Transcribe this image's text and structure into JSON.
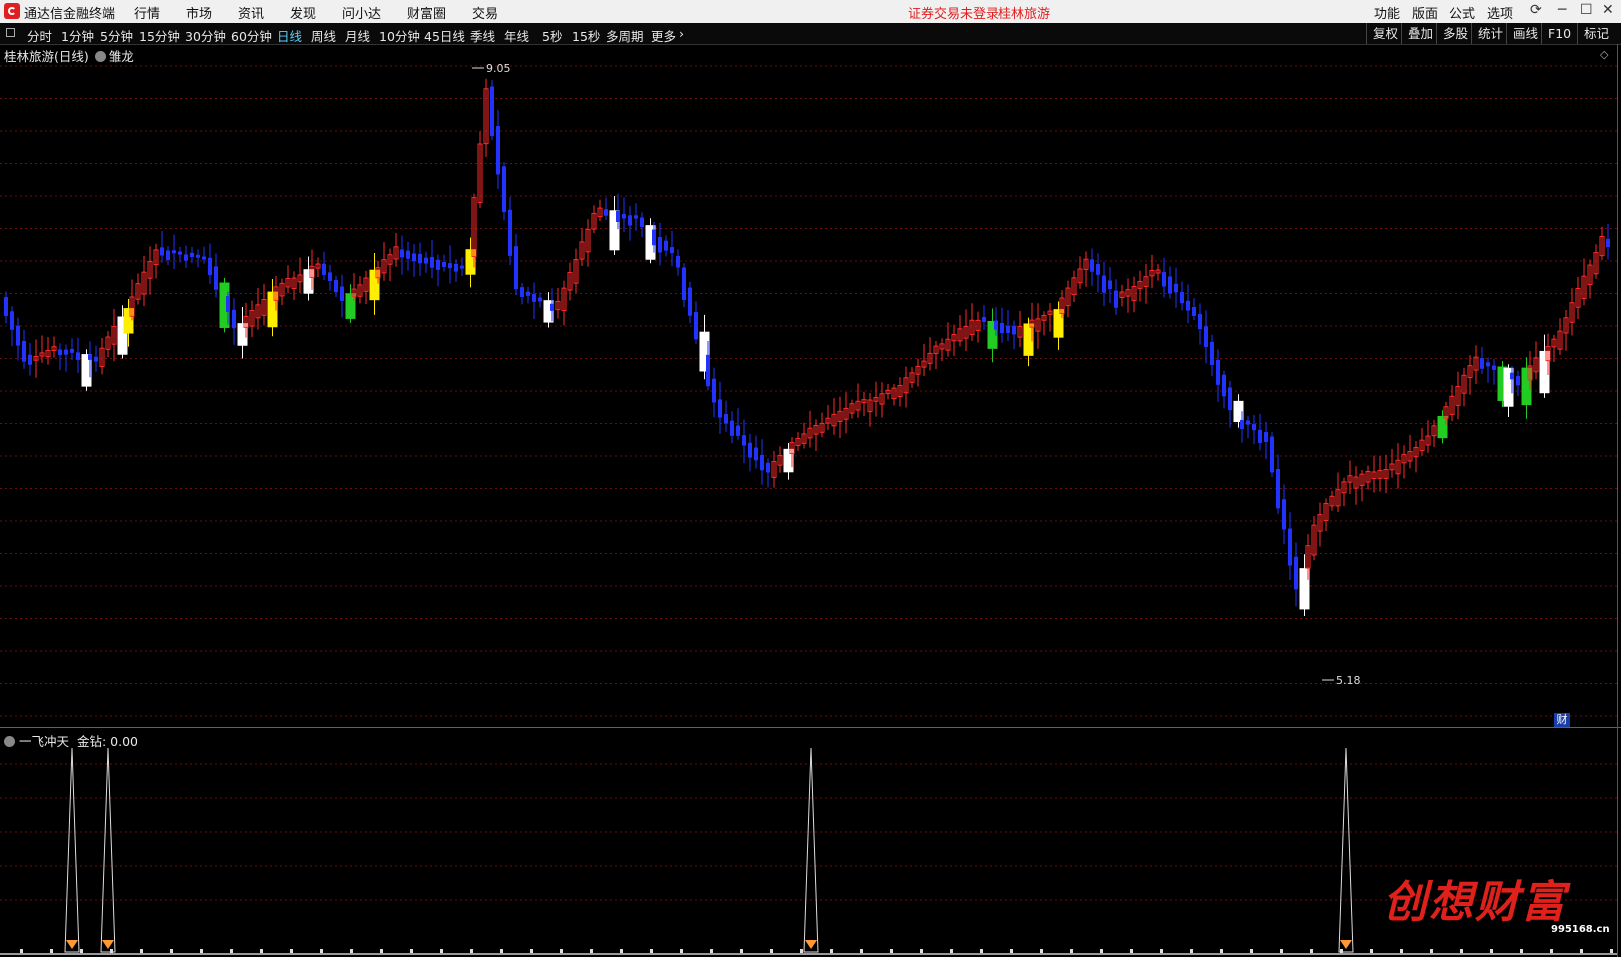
{
  "menubar": {
    "app_title": "通达信金融终端",
    "items": [
      "行情",
      "市场",
      "资讯",
      "发现",
      "问小达",
      "财富圈",
      "交易"
    ],
    "notice": "证券交易未登录",
    "stock_name": "桂林旅游",
    "right_items": [
      "功能",
      "版面",
      "公式",
      "选项"
    ]
  },
  "periods": {
    "items": [
      "分时",
      "1分钟",
      "5分钟",
      "15分钟",
      "30分钟",
      "60分钟",
      "日线",
      "周线",
      "月线",
      "10分钟",
      "45日线",
      "季线",
      "年线",
      "5秒",
      "15秒",
      "多周期",
      "更多"
    ],
    "active": "日线",
    "tools": [
      "复权",
      "叠加",
      "多股",
      "统计",
      "画线",
      "F10",
      "标记"
    ]
  },
  "chart": {
    "title": "桂林旅游(日线)",
    "indicator_name": "雏龙",
    "high_label": "9.05",
    "low_label": "5.18",
    "badge": "财",
    "colors": {
      "up": "#ff2a2a",
      "down": "#2233ff",
      "yellow": "#ffee00",
      "white": "#ffffff",
      "green": "#22cc22",
      "grid": "#6a1010"
    }
  },
  "indicator": {
    "title": "一飞冲天",
    "field": "金钻: 0.00"
  },
  "watermark": {
    "text": "创想财富",
    "url": "995168.cn"
  }
}
